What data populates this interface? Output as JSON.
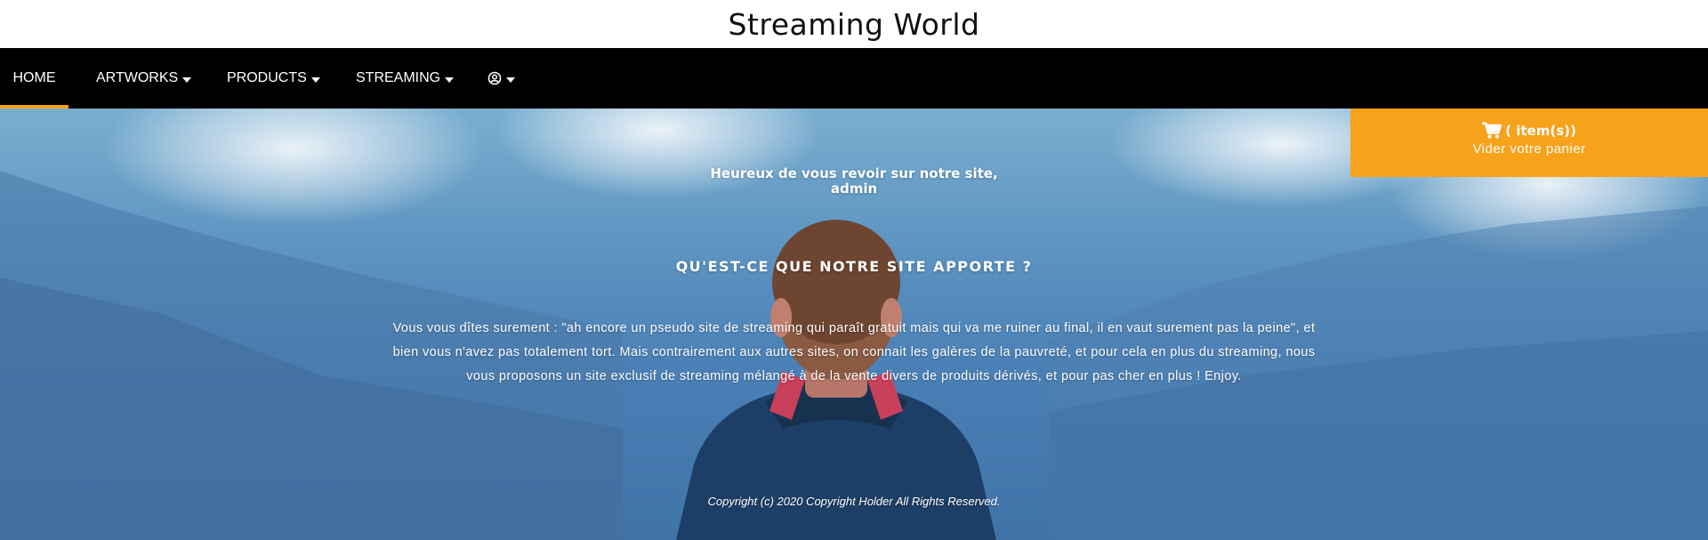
{
  "header": {
    "title": "Streaming World"
  },
  "nav": {
    "items": [
      {
        "label": "HOME",
        "active": true,
        "dropdown": false
      },
      {
        "label": "ARTWORKS",
        "dropdown": true
      },
      {
        "label": "PRODUCTS",
        "dropdown": true
      },
      {
        "label": "STREAMING",
        "dropdown": true
      },
      {
        "label": "",
        "icon": "user-circle-icon",
        "dropdown": true
      }
    ]
  },
  "cart": {
    "icon": "shopping-cart-icon",
    "items_label": "( item(s))",
    "empty_label": "Vider votre panier",
    "color": "#f7a21b"
  },
  "hero": {
    "welcome_line1": "Heureux de vous revoir sur notre site,",
    "welcome_line2": "admin",
    "section_title": "QU'EST-CE QUE NOTRE SITE APPORTE ?",
    "description": "Vous vous dîtes surement : \"ah encore un pseudo site de streaming qui paraît gratuit mais qui va me ruiner au final, il en vaut surement pas la peine\", et bien vous n'avez pas totalement tort. Mais contrairement aux autres sites, on connait les galères de la pauvreté, et pour cela en plus du streaming, nous vous proposons un site exclusif de streaming mélangé à de la vente divers de produits dérivés, et pour pas cher en plus ! Enjoy.",
    "copyright": "Copyright (c) 2020 Copyright Holder All Rights Reserved."
  },
  "colors": {
    "accent": "#f7a21b",
    "navbar": "#000000",
    "hero_blue": "#4a80b6"
  }
}
